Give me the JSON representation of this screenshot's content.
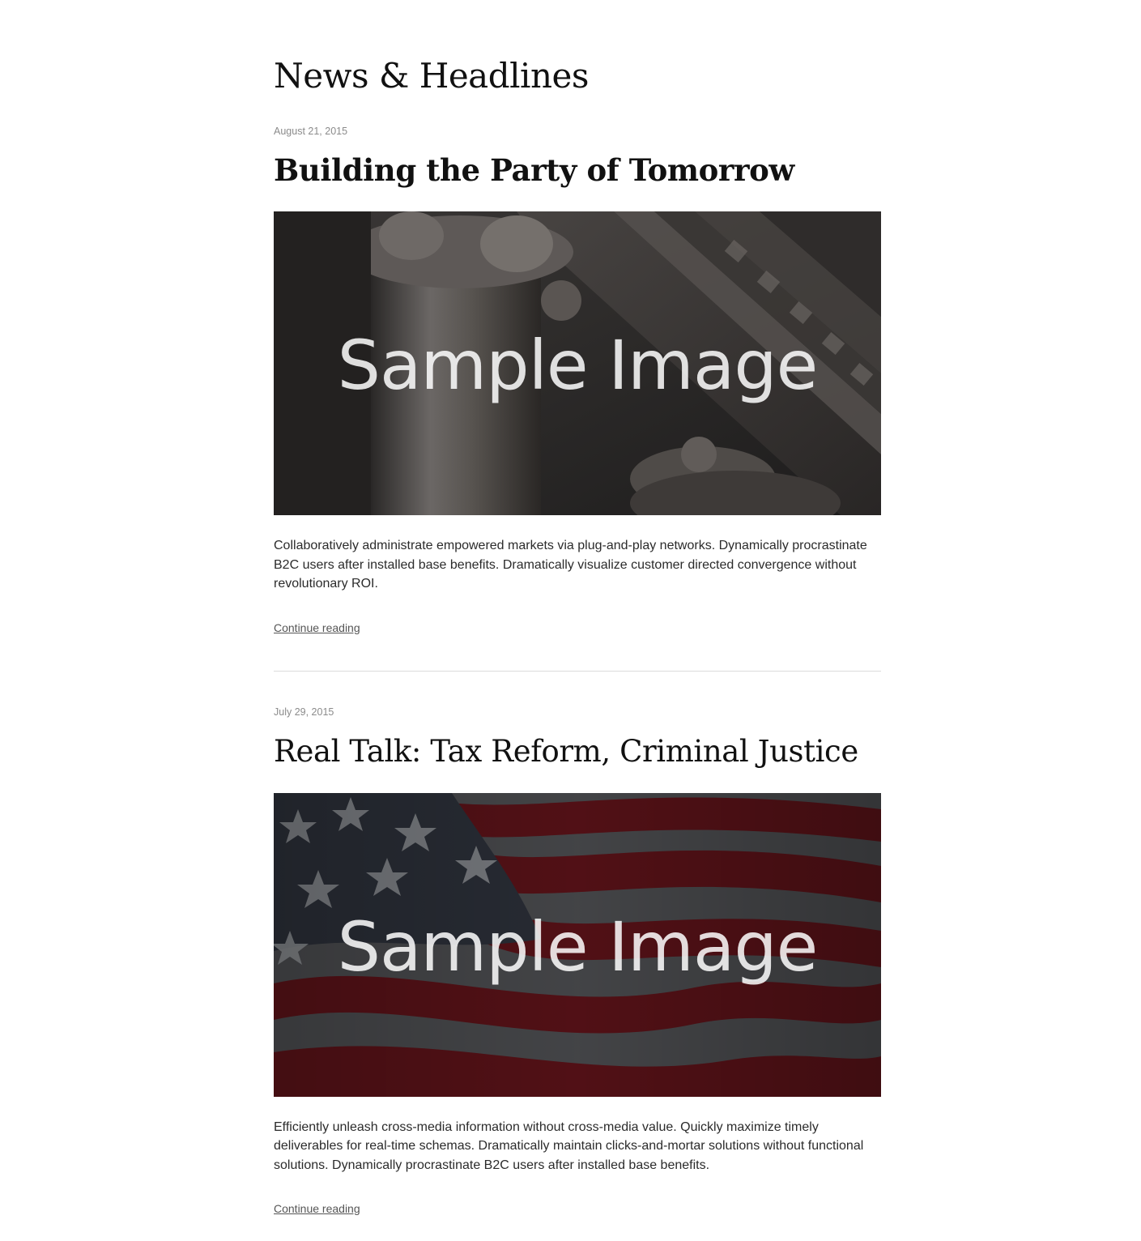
{
  "page": {
    "title": "News & Headlines"
  },
  "posts": [
    {
      "date": "August 21, 2015",
      "title": "Building the Party of Tomorrow",
      "image_caption": "Sample Image",
      "image_subject": "classical-columns",
      "excerpt": "Collaboratively administrate empowered markets via plug-and-play networks. Dynamically procrastinate B2C users after installed base benefits. Dramatically visualize customer directed convergence without revolutionary ROI.",
      "link_label": "Continue reading"
    },
    {
      "date": "July 29, 2015",
      "title": "Real Talk: Tax Reform, Criminal Justice",
      "image_caption": "Sample Image",
      "image_subject": "american-flag",
      "excerpt": "Efficiently unleash cross-media information without cross-media value. Quickly maximize timely deliverables for real-time schemas. Dramatically maintain clicks-and-mortar solutions without functional solutions. Dynamically procrastinate B2C users after installed base benefits.",
      "link_label": "Continue reading"
    }
  ],
  "colors": {
    "date": "#8b8b8b",
    "link": "#555555",
    "divider": "#dcdcdc",
    "flag_red": "#5a1218",
    "flag_white": "#9a9a9a",
    "flag_blue": "#2b2f38"
  }
}
